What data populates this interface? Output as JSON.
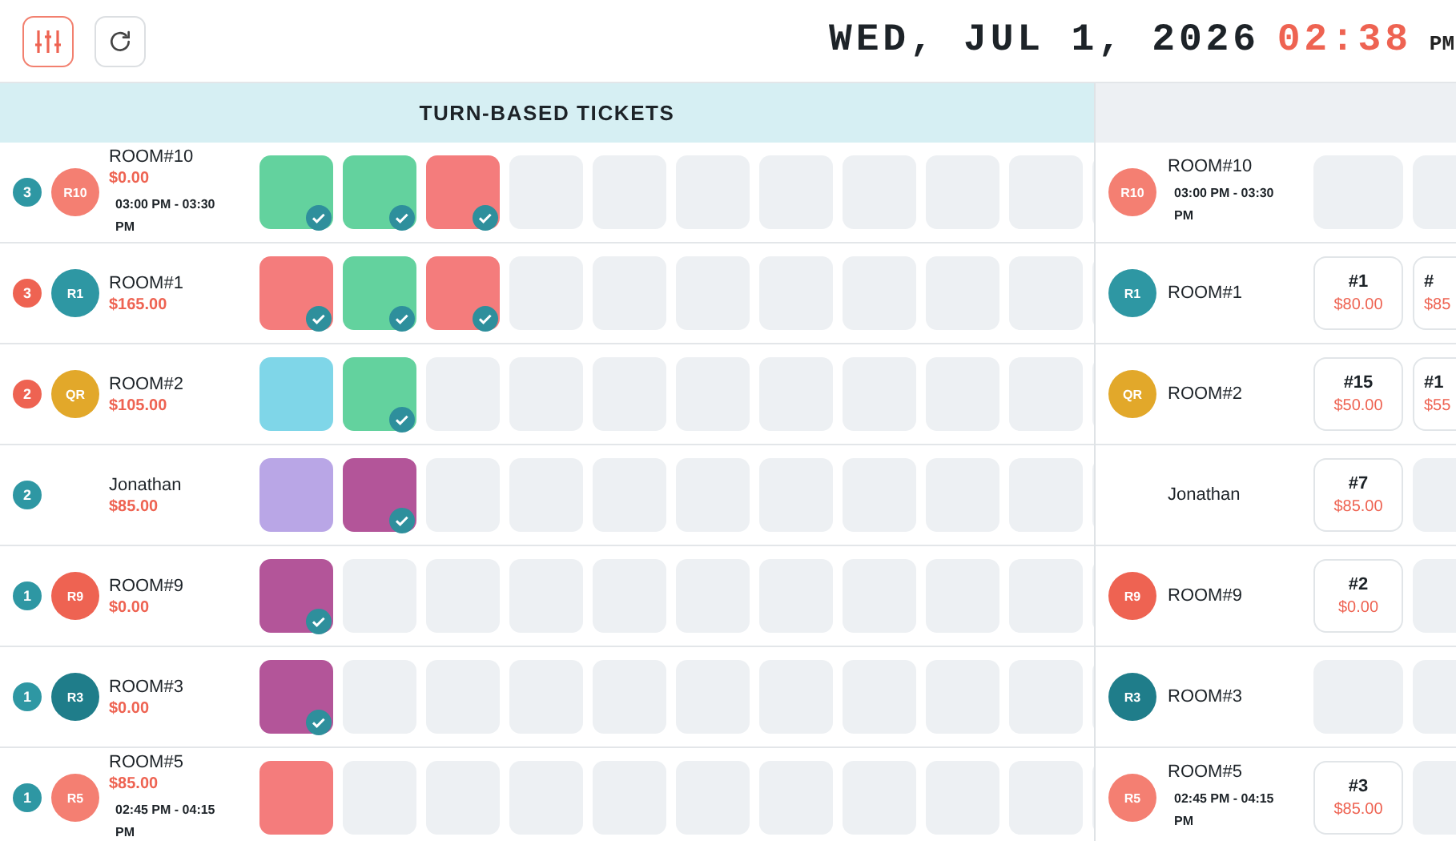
{
  "header": {
    "date": "WED, JUL 1, 2026",
    "time": "02:38",
    "meridiem": "PM"
  },
  "turn_based": {
    "title": "TURN-BASED TICKETS",
    "rows": [
      {
        "badge": {
          "text": "3",
          "color": "#2e97a3"
        },
        "avatar": {
          "text": "R10",
          "color": "#f47f72"
        },
        "name": "ROOM#10",
        "amount": "$0.00",
        "time": "03:00 PM - 03:30 PM",
        "tickets": [
          {
            "color": "#63d29e",
            "checked": true
          },
          {
            "color": "#63d29e",
            "checked": true
          },
          {
            "color": "#f47c7c",
            "checked": true
          }
        ]
      },
      {
        "badge": {
          "text": "3",
          "color": "#ee6352"
        },
        "avatar": {
          "text": "R1",
          "color": "#2e97a3"
        },
        "name": "ROOM#1",
        "amount": "$165.00",
        "tickets": [
          {
            "color": "#f47c7c",
            "checked": true
          },
          {
            "color": "#63d29e",
            "checked": true
          },
          {
            "color": "#f47c7c",
            "checked": true
          }
        ]
      },
      {
        "badge": {
          "text": "2",
          "color": "#ee6352"
        },
        "avatar": {
          "text": "QR",
          "color": "#e2a82a"
        },
        "name": "ROOM#2",
        "amount": "$105.00",
        "tickets": [
          {
            "color": "#7fd6e8",
            "checked": false
          },
          {
            "color": "#63d29e",
            "checked": true
          }
        ]
      },
      {
        "badge": {
          "text": "2",
          "color": "#2e97a3"
        },
        "name": "Jonathan",
        "amount": "$85.00",
        "tickets": [
          {
            "color": "#b9a6e6",
            "checked": false
          },
          {
            "color": "#b35599",
            "checked": true
          }
        ]
      },
      {
        "badge": {
          "text": "1",
          "color": "#2e97a3"
        },
        "avatar": {
          "text": "R9",
          "color": "#ee6352"
        },
        "name": "ROOM#9",
        "amount": "$0.00",
        "tickets": [
          {
            "color": "#b35599",
            "checked": true
          }
        ]
      },
      {
        "badge": {
          "text": "1",
          "color": "#2e97a3"
        },
        "avatar": {
          "text": "R3",
          "color": "#1f7d8a"
        },
        "name": "ROOM#3",
        "amount": "$0.00",
        "tickets": [
          {
            "color": "#b35599",
            "checked": true
          }
        ]
      },
      {
        "badge": {
          "text": "1",
          "color": "#2e97a3"
        },
        "avatar": {
          "text": "R5",
          "color": "#f47f72"
        },
        "name": "ROOM#5",
        "amount": "$85.00",
        "time": "02:45 PM - 04:15 PM",
        "tickets": [
          {
            "color": "#f47c7c",
            "checked": false
          }
        ]
      }
    ]
  },
  "queue": {
    "rows": [
      {
        "avatar": {
          "text": "R10",
          "color": "#f47f72"
        },
        "name": "ROOM#10",
        "time": "03:00 PM - 03:30 PM",
        "cards": [
          {
            "kind": "empty"
          },
          {
            "kind": "empty"
          }
        ]
      },
      {
        "avatar": {
          "text": "R1",
          "color": "#2e97a3"
        },
        "name": "ROOM#1",
        "cards": [
          {
            "kind": "ticket",
            "number": "#1",
            "amount": "$80.00",
            "clipped": false
          },
          {
            "kind": "ticket",
            "number": "#",
            "amount": "$85",
            "clipped": true
          }
        ]
      },
      {
        "avatar": {
          "text": "QR",
          "color": "#e2a82a"
        },
        "name": "ROOM#2",
        "cards": [
          {
            "kind": "ticket",
            "number": "#15",
            "amount": "$50.00",
            "clipped": false
          },
          {
            "kind": "ticket",
            "number": "#1",
            "amount": "$55",
            "clipped": true
          }
        ]
      },
      {
        "name": "Jonathan",
        "cards": [
          {
            "kind": "ticket",
            "number": "#7",
            "amount": "$85.00",
            "clipped": false
          },
          {
            "kind": "empty"
          }
        ]
      },
      {
        "avatar": {
          "text": "R9",
          "color": "#ee6352"
        },
        "name": "ROOM#9",
        "cards": [
          {
            "kind": "ticket",
            "number": "#2",
            "amount": "$0.00",
            "clipped": false
          },
          {
            "kind": "empty"
          }
        ]
      },
      {
        "avatar": {
          "text": "R3",
          "color": "#1f7d8a"
        },
        "name": "ROOM#3",
        "cards": [
          {
            "kind": "empty"
          },
          {
            "kind": "empty"
          }
        ]
      },
      {
        "avatar": {
          "text": "R5",
          "color": "#f47f72"
        },
        "name": "ROOM#5",
        "time": "02:45 PM - 04:15 PM",
        "cards": [
          {
            "kind": "ticket",
            "number": "#3",
            "amount": "$85.00",
            "clipped": false
          },
          {
            "kind": "empty"
          }
        ]
      }
    ]
  }
}
